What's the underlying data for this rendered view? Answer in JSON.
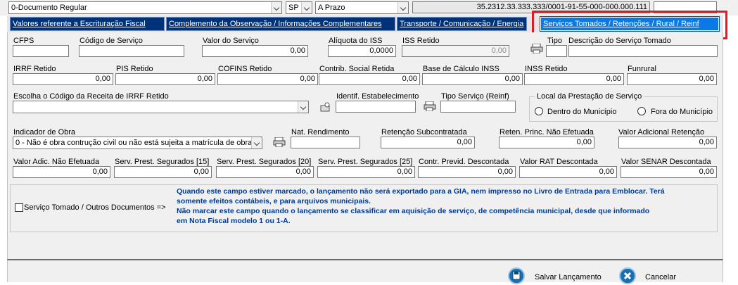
{
  "top": {
    "documento": "0-Documento Regular",
    "uf": "SP",
    "condicao": "A Prazo",
    "chave": "35.2312.33.333.333/0001-91-55-000-000.000.111"
  },
  "tabs": [
    {
      "label": "Valores referente a Escrituração Fiscal"
    },
    {
      "label": "Complemento da Observação / Informações Complementares"
    },
    {
      "label": "Transporte / Comunicação / Energia"
    },
    {
      "label": "Serviços Tomados / Retenções / Rural / Reinf"
    }
  ],
  "row1": {
    "cfps_label": "CFPS",
    "codigo_servico_label": "Código de Serviço",
    "valor_servico_label": "Valor do Serviço",
    "valor_servico": "0,00",
    "aliquota_iss_label": "Alíquota do ISS",
    "aliquota_iss": "0,0000",
    "iss_retido_label": "ISS Retido",
    "iss_retido": "0,00",
    "tipo_label": "Tipo",
    "descricao_label": "Descrição do Serviço Tomado"
  },
  "row2": {
    "irrf_label": "IRRF Retido",
    "irrf": "0,00",
    "pis_label": "PIS Retido",
    "pis": "0,00",
    "cofins_label": "COFINS Retido",
    "cofins": "0,00",
    "csll_label": "Contrib. Social Retida",
    "csll": "0,00",
    "base_inss_label": "Base de Cálculo INSS",
    "base_inss": "0,00",
    "inss_label": "INSS Retido",
    "inss": "0,00",
    "funrural_label": "Funrural",
    "funrural": "0,00"
  },
  "row3": {
    "receita_irrf_label": "Escolha o Código da Receita de IRRF Retido",
    "identif_label": "Identif. Estabelecimento",
    "tipo_servico_label": "Tipo Serviço (Reinf)",
    "local_group_label": "Local da Prestação de Serviço",
    "dentro_label": "Dentro do Município",
    "fora_label": "Fora do Município"
  },
  "row4": {
    "indicador_label": "Indicador de Obra",
    "indicador_value": "0 - Não é obra contrução civil ou não está sujeita a matrícula de obra",
    "nat_rend_label": "Nat. Rendimento",
    "ret_sub_label": "Retenção Subcontratada",
    "ret_sub": "0,00",
    "ret_princ_label": "Reten. Princ. Não Efetuada",
    "ret_princ": "0,00",
    "val_adic_label": "Valor Adicional Retenção",
    "val_adic": "0,00"
  },
  "row5": {
    "adic_nao_label": "Valor Adic. Não Efetuada",
    "adic_nao": "0,00",
    "seg15_label": "Serv. Prest. Segurados [15]",
    "seg15": "0,00",
    "seg20_label": "Serv. Prest. Segurados [20]",
    "seg20": "0,00",
    "seg25_label": "Serv. Prest. Segurados [25]",
    "seg25": "0,00",
    "contr_label": "Contr. Previd. Descontada",
    "contr": "0,00",
    "rat_label": "Valor RAT Descontada",
    "rat": "0,00",
    "senar_label": "Valor SENAR Descontada",
    "senar": "0,00"
  },
  "notice": {
    "checkbox_label": "Serviço Tomado / Outros Documentos  =>",
    "line1": "Quando este campo estiver marcado, o lançamento não será exportado para a GIA, nem impresso no Livro de Entrada para Emblocar. Terá",
    "line2": "somente efeitos contábeis, e para arquivos municipais.",
    "line3": "Não marcar este campo quando o lançamento se classificar em aquisição de serviço, de competência municipal, desde que informado",
    "line4": "em Nota Fiscal modelo 1 ou 1-A."
  },
  "footer": {
    "save_label": "Salvar Lançamento",
    "cancel_label": "Cancelar"
  },
  "colors": {
    "tab_bg": "#00327a",
    "tab_active": "#0a78e6",
    "highlight": "#e01b24",
    "notice_text": "#003a8c"
  }
}
